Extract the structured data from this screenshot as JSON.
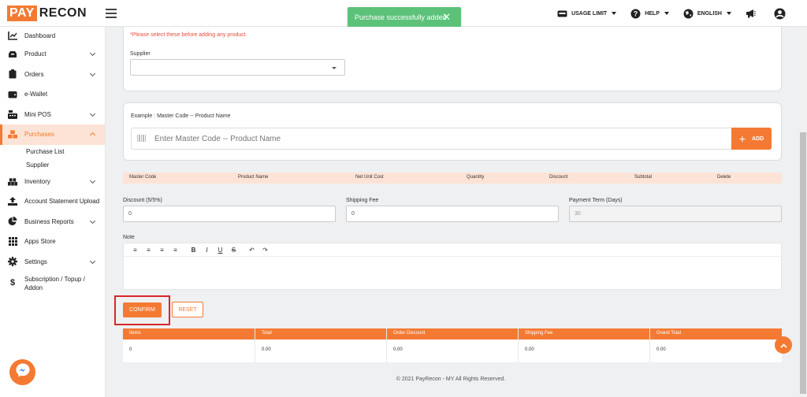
{
  "brand": {
    "pay": "PAY",
    "recon": "RECON"
  },
  "toast": {
    "message": "Purchase successfully added"
  },
  "header": {
    "usage_limit": "USAGE LIMIT",
    "help": "HELP",
    "language": "ENGLISH"
  },
  "sidebar": {
    "items": [
      {
        "label": "Dashboard"
      },
      {
        "label": "Product"
      },
      {
        "label": "Orders"
      },
      {
        "label": "e-Wallet"
      },
      {
        "label": "Mini POS"
      },
      {
        "label": "Purchases"
      },
      {
        "label": "Inventory"
      },
      {
        "label": "Account Statement Upload"
      },
      {
        "label": "Business Reports"
      },
      {
        "label": "Apps Store"
      },
      {
        "label": "Settings"
      },
      {
        "label": "Subscription / Topup / Addon"
      }
    ],
    "purchases_sub": [
      {
        "label": "Purchase List"
      },
      {
        "label": "Supplier"
      }
    ]
  },
  "form": {
    "warning": "*Please select these before adding any product",
    "supplier_label": "Supplier",
    "example_label": "Example : Master Code -- Product Name",
    "product_placeholder": "Enter Master Code -- Product Name",
    "add_label": "ADD",
    "columns": [
      "Master Code",
      "Product Name",
      "Net Unit Cost",
      "Quantity",
      "Discount",
      "Subtotal",
      "Delete"
    ],
    "discount_label": "Discount (5/5%)",
    "discount_value": "0",
    "shipping_label": "Shipping Fee",
    "shipping_value": "0",
    "payment_label": "Payment Term (Days)",
    "payment_value": "30",
    "note_label": "Note",
    "confirm_label": "CONFIRM",
    "reset_label": "RESET"
  },
  "summary": {
    "headers": [
      "Items",
      "Total",
      "Order Discount",
      "Shipping Fee",
      "Grand Total"
    ],
    "values": [
      "0",
      "0.00",
      "0.00",
      "0.00",
      "0.00"
    ]
  },
  "footer": {
    "text": "© 2021 PayRecon - MY All Rights Reserved."
  },
  "colors": {
    "accent": "#f47a33",
    "toast": "#5cc27a",
    "highlight": "#d9262b"
  }
}
